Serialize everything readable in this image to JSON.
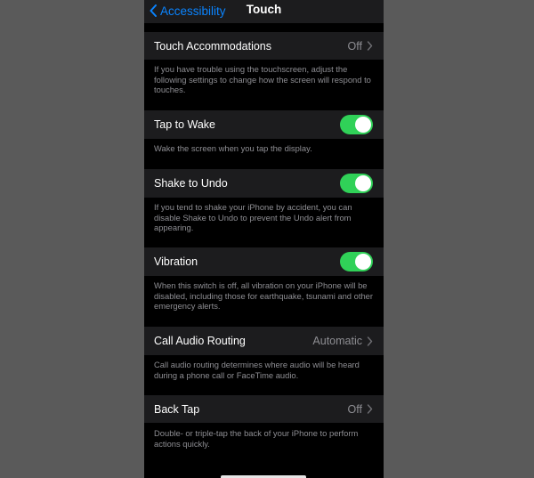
{
  "nav": {
    "back_label": "Accessibility",
    "title": "Touch"
  },
  "rows": {
    "touch_accommodations": {
      "label": "Touch Accommodations",
      "value": "Off",
      "footer": "If you have trouble using the touchscreen, adjust the following settings to change how the screen will respond to touches."
    },
    "tap_to_wake": {
      "label": "Tap to Wake",
      "on": true,
      "footer": "Wake the screen when you tap the display."
    },
    "shake_to_undo": {
      "label": "Shake to Undo",
      "on": true,
      "footer": "If you tend to shake your iPhone by accident, you can disable Shake to Undo to prevent the Undo alert from appearing."
    },
    "vibration": {
      "label": "Vibration",
      "on": true,
      "footer": "When this switch is off, all vibration on your iPhone will be disabled, including those for earthquake, tsunami and other emergency alerts."
    },
    "call_audio_routing": {
      "label": "Call Audio Routing",
      "value": "Automatic",
      "footer": "Call audio routing determines where audio will be heard during a phone call or FaceTime audio."
    },
    "back_tap": {
      "label": "Back Tap",
      "value": "Off",
      "footer": "Double- or triple-tap the back of your iPhone to perform actions quickly."
    }
  },
  "colors": {
    "accent": "#0a84ff",
    "toggle_on": "#30d158",
    "cell_background": "#1c1c1e",
    "secondary_text": "#8e8e93"
  },
  "icons": {
    "back": "chevron-left-icon",
    "disclosure": "chevron-right-icon"
  }
}
